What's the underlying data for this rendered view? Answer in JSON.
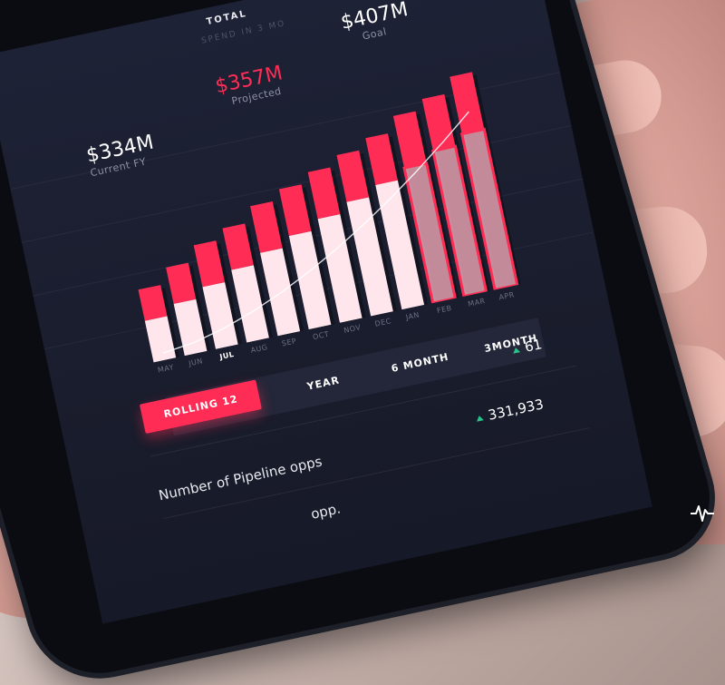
{
  "header": {
    "title": "TOTAL",
    "subtitle": "SPEND IN 3 MO"
  },
  "stats": {
    "current": {
      "value": "$334M",
      "label": "Current FY"
    },
    "projected": {
      "value": "$357M",
      "label": "Projected"
    },
    "goal": {
      "value": "$407M",
      "label": "Goal"
    }
  },
  "colors": {
    "accent": "#ff2d55",
    "bar_top": "#ff2d55",
    "bar_bottom": "#ffe6ec",
    "positive": "#27c48a",
    "screen_bg": "#1e2236"
  },
  "chart_data": {
    "type": "bar",
    "categories": [
      "MAY",
      "JUN",
      "JUL",
      "AUG",
      "SEP",
      "OCT",
      "NOV",
      "DEC",
      "JAN",
      "FEB",
      "MAR",
      "APR"
    ],
    "highlighted_category": "JUL",
    "series": [
      {
        "values": [
          8,
          10,
          12,
          14,
          16,
          18,
          20,
          22,
          24,
          26,
          28,
          30
        ]
      },
      {
        "values": [
          6,
          7,
          8,
          8,
          9,
          9,
          9,
          9,
          9,
          10,
          10,
          11
        ]
      }
    ],
    "projected_from_index": 9,
    "trend_line": true
  },
  "range_tabs": {
    "items": [
      "ROLLING 12",
      "YEAR",
      "6 MONTH",
      "3MONTH"
    ],
    "active": "ROLLING 12"
  },
  "metrics": [
    {
      "label": "",
      "value": "61",
      "trend": "up"
    },
    {
      "label": "Number of Pipeline opps",
      "value": "331,933",
      "trend": "up"
    },
    {
      "label": "opp.",
      "value": "",
      "trend": ""
    }
  ],
  "icons": {
    "brand": "pulse-logo-icon",
    "trend": "triangle-up-icon"
  }
}
